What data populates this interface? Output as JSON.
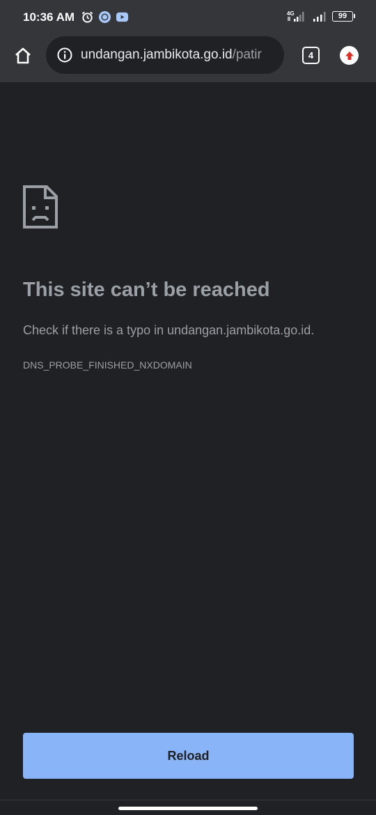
{
  "status_bar": {
    "time": "10:36 AM",
    "network_label": "4G",
    "battery": "99",
    "left_icons": [
      "alarm-icon",
      "messenger-icon",
      "youtube-icon"
    ]
  },
  "toolbar": {
    "url_host": "undangan.jambikota.go.id",
    "url_path": "/patir",
    "tab_count": "4"
  },
  "error": {
    "title": "This site can’t be reached",
    "description": "Check if there is a typo in undangan.jambikota.go.id.",
    "code": "DNS_PROBE_FINISHED_NXDOMAIN"
  },
  "actions": {
    "reload_label": "Reload"
  },
  "colors": {
    "background": "#202124",
    "toolbar": "#35363a",
    "text_secondary": "#9aa0a6",
    "button": "#8ab4f8",
    "update_arrow": "#d93025"
  }
}
